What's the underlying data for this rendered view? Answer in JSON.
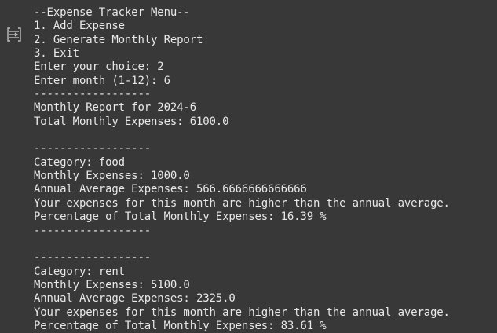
{
  "gutter": {
    "icon": "output-collapse-icon"
  },
  "output": {
    "lines": [
      "--Expense Tracker Menu--",
      "1. Add Expense",
      "2. Generate Monthly Report",
      "3. Exit",
      "Enter your choice: 2",
      "Enter month (1-12): 6",
      "------------------",
      "Monthly Report for 2024-6",
      "Total Monthly Expenses: 6100.0",
      "",
      "------------------",
      "Category: food",
      "Monthly Expenses: 1000.0",
      "Annual Average Expenses: 566.6666666666666",
      "Your expenses for this month are higher than the annual average.",
      "Percentage of Total Monthly Expenses: 16.39 %",
      "------------------",
      "",
      "------------------",
      "Category: rent",
      "Monthly Expenses: 5100.0",
      "Annual Average Expenses: 2325.0",
      "Your expenses for this month are higher than the annual average.",
      "Percentage of Total Monthly Expenses: 83.61 %"
    ]
  }
}
